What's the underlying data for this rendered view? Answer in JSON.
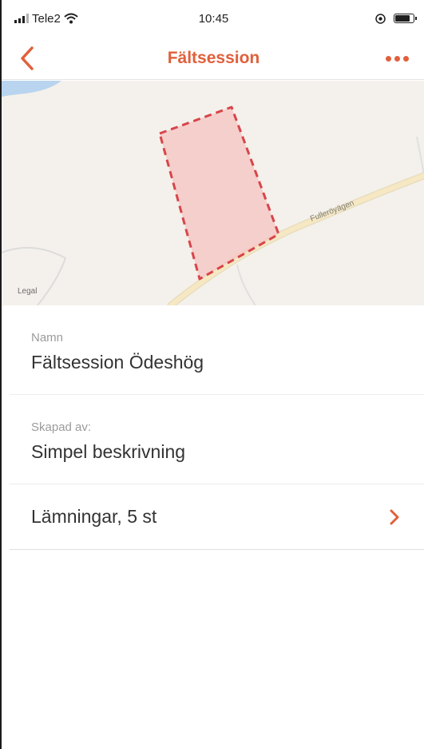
{
  "status_bar": {
    "carrier": "Tele2",
    "time": "10:45"
  },
  "nav": {
    "title": "Fältsession",
    "back_icon": "chevron-left-icon",
    "more_icon": "more-horizontal-icon"
  },
  "map": {
    "road_label": "Fulleröyägen",
    "attribution": "Legal"
  },
  "fields": [
    {
      "label": "Namn",
      "value": "Fältsession Ödeshög"
    },
    {
      "label": "Skapad av:",
      "value": "Simpel beskrivning"
    }
  ],
  "remains_row": {
    "label": "Lämningar, 5 st",
    "icon": "chevron-right-icon"
  },
  "colors": {
    "accent": "#e0603b",
    "polygon_fill": "#f4c9c6",
    "polygon_stroke": "#d8454a",
    "road": "#f3dfae",
    "water": "#b9d4ee"
  }
}
